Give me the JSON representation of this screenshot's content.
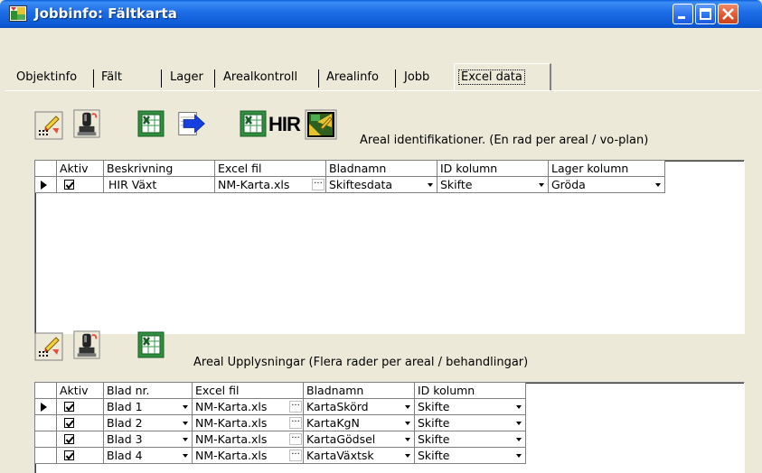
{
  "window": {
    "title": "Jobbinfo: Fältkarta"
  },
  "tabs": [
    {
      "label": "Objektinfo"
    },
    {
      "label": "Fält"
    },
    {
      "label": "Lager"
    },
    {
      "label": "Arealkontroll"
    },
    {
      "label": "Arealinfo"
    },
    {
      "label": "Jobb"
    },
    {
      "label": "Excel data",
      "selected": true
    }
  ],
  "top_section": {
    "hir_label": "HIR",
    "caption": "Areal identifikationer. (En rad per areal / vo-plan)",
    "columns": [
      "Aktiv",
      "Beskrivning",
      "Excel fil",
      "Bladnamn",
      "ID kolumn",
      "Lager kolumn"
    ],
    "rows": [
      {
        "aktiv": true,
        "beskrivning": "HIR Växt",
        "excel_fil": "NM-Karta.xls",
        "bladnamn": "Skiftesdata",
        "id_kolumn": "Skifte",
        "lager_kolumn": "Gröda"
      }
    ]
  },
  "bottom_section": {
    "caption": "Areal Upplysningar (Flera rader per areal / behandlingar)",
    "columns": [
      "Aktiv",
      "Blad nr.",
      "Excel fil",
      "Bladnamn",
      "ID kolumn"
    ],
    "rows": [
      {
        "aktiv": true,
        "blad_nr": "Blad 1",
        "excel_fil": "NM-Karta.xls",
        "bladnamn": "KartaSkörd",
        "id_kolumn": "Skifte"
      },
      {
        "aktiv": true,
        "blad_nr": "Blad 2",
        "excel_fil": "NM-Karta.xls",
        "bladnamn": "KartaKgN",
        "id_kolumn": "Skifte"
      },
      {
        "aktiv": true,
        "blad_nr": "Blad 3",
        "excel_fil": "NM-Karta.xls",
        "bladnamn": "KartaGödsel",
        "id_kolumn": "Skifte"
      },
      {
        "aktiv": true,
        "blad_nr": "Blad 4",
        "excel_fil": "NM-Karta.xls",
        "bladnamn": "KartaVäxtsk",
        "id_kolumn": "Skifte"
      }
    ]
  },
  "icons": {
    "app": "map-app-icon",
    "edit_list": "edit-list-icon",
    "joystick": "joystick-icon",
    "excel": "excel-icon",
    "export": "export-arrow-icon",
    "hir_map": "map-edit-icon"
  },
  "colors": {
    "titlebar": "#0b58d3",
    "close": "#e0542e",
    "face": "#ece9d8",
    "arrow": "#1540e0"
  }
}
